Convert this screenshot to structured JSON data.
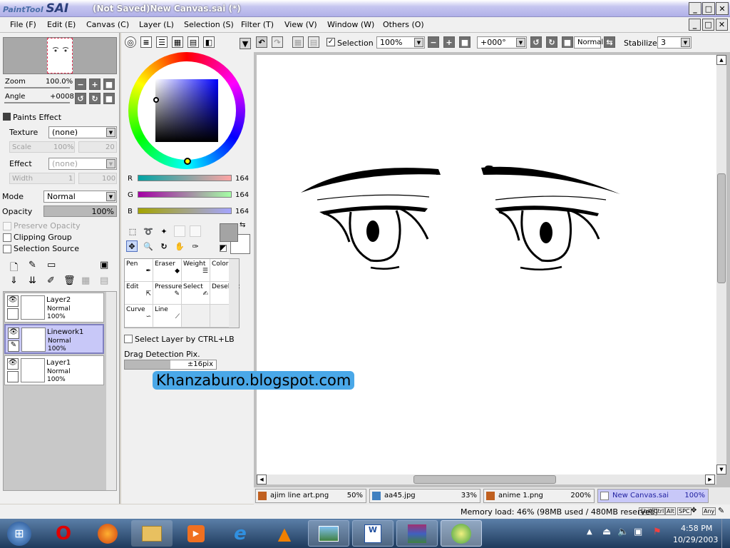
{
  "titlebar": {
    "logo_small": "PaintTool",
    "logo_big": "SAI",
    "title": "(Not Saved)New Canvas.sai (*)"
  },
  "menu": [
    "File (F)",
    "Edit (E)",
    "Canvas (C)",
    "Layer (L)",
    "Selection (S)",
    "Filter (T)",
    "View (V)",
    "Window (W)",
    "Others (O)"
  ],
  "nav": {
    "zoom_label": "Zoom",
    "zoom_value": "100.0%",
    "angle_label": "Angle",
    "angle_value": "+0008"
  },
  "paints": {
    "title": "Paints Effect",
    "texture_label": "Texture",
    "texture_value": "(none)",
    "scale_label": "Scale",
    "scale_value": "100%",
    "scale_num": "20",
    "effect_label": "Effect",
    "effect_value": "(none)",
    "width_label": "Width",
    "width_value": "1",
    "width_num": "100"
  },
  "layerprops": {
    "mode_label": "Mode",
    "mode_value": "Normal",
    "opacity_label": "Opacity",
    "opacity_value": "100%",
    "preserve": "Preserve Opacity",
    "clipping": "Clipping Group",
    "selsource": "Selection Source"
  },
  "layers": [
    {
      "name": "Layer2",
      "mode": "Normal",
      "opacity": "100%"
    },
    {
      "name": "Linework1",
      "mode": "Normal",
      "opacity": "100%"
    },
    {
      "name": "Layer1",
      "mode": "Normal",
      "opacity": "100%"
    }
  ],
  "rgb": {
    "r_label": "R",
    "r": "164",
    "g_label": "G",
    "g": "164",
    "b_label": "B",
    "b": "164"
  },
  "tools": [
    [
      "Pen",
      "Eraser",
      "Weight",
      "Color"
    ],
    [
      "Edit",
      "Pressure",
      "Select",
      "Deselect"
    ],
    [
      "Curve",
      "Line",
      "",
      ""
    ]
  ],
  "toolopts": {
    "selectlayer": "Select Layer by CTRL+LB",
    "drag_label": "Drag Detection Pix.",
    "drag_value": "±16pix"
  },
  "toolbar": {
    "selection": "Selection",
    "zoom": "100%",
    "angle": "+000°",
    "mode": "Normal",
    "stabilizer_label": "Stabilizer",
    "stabilizer": "3"
  },
  "doctabs": [
    {
      "name": "ajim line art.png",
      "zoom": "50%"
    },
    {
      "name": "aa45.jpg",
      "zoom": "33%"
    },
    {
      "name": "anime 1.png",
      "zoom": "200%"
    },
    {
      "name": "New Canvas.sai",
      "zoom": "100%"
    }
  ],
  "status": {
    "memory": "Memory load: 46% (98MB used / 480MB reserved)",
    "keys": [
      "Shift",
      "Ctrl",
      "Alt",
      "SPC",
      "Any"
    ]
  },
  "watermark": "Khanzaburo.blogspot.com",
  "clock": {
    "time": "4:58 PM",
    "date": "10/29/2003"
  },
  "colors": {
    "accent": "#b0b0e8",
    "selected_layer": "#c8c8f8",
    "watermark": "#4aa8e8"
  }
}
